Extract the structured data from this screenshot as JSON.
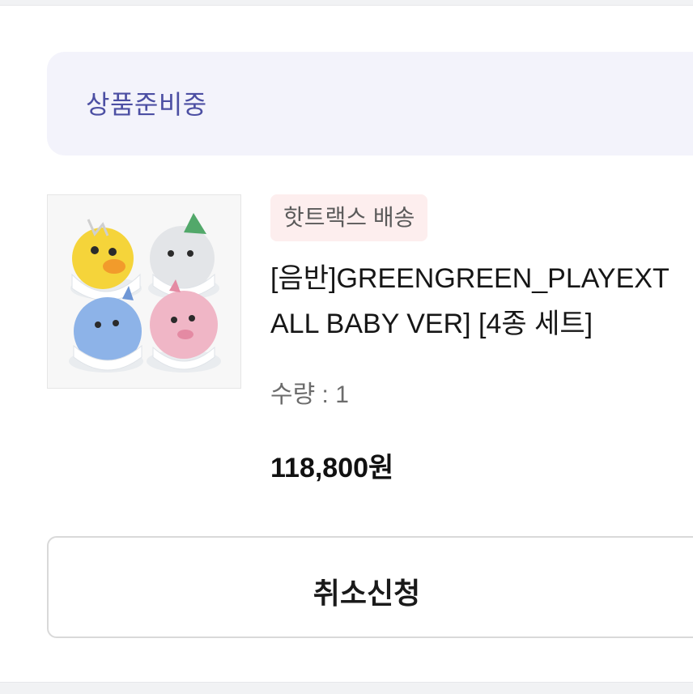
{
  "order": {
    "status": "상품준비중",
    "shipping_badge": "핫트랙스 배송",
    "product": {
      "title_line1": "[음반]GREENGREEN_PLAYEXT",
      "title_line2": "ALL BABY VER] [4종 세트]",
      "quantity": "수량 : 1",
      "price": "118,800원",
      "image_icon": "plush-toys-set-thumbnail"
    },
    "cancel_button_label": "취소신청"
  },
  "colors": {
    "status_text": "#4c4fa3",
    "status_bg": "#f3f3fb",
    "badge_bg": "#fdeeee"
  }
}
